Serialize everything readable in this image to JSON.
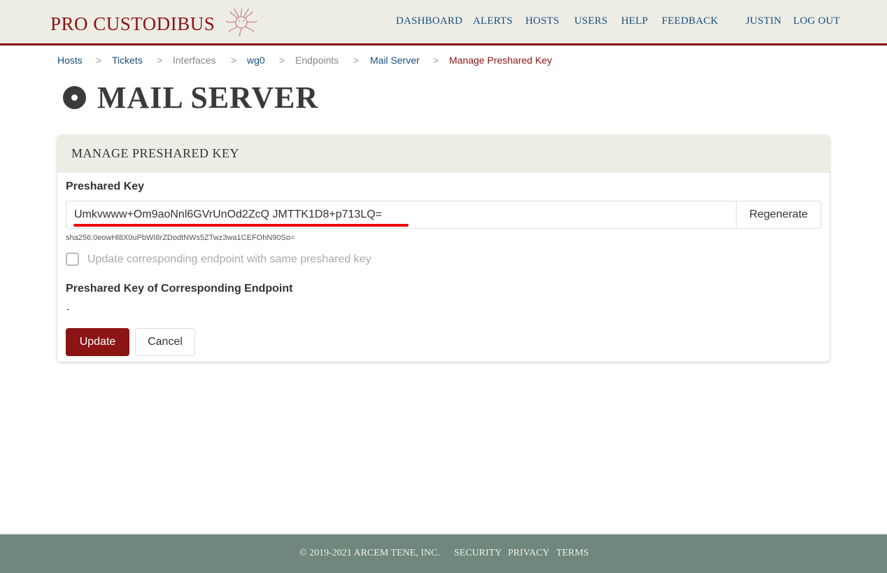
{
  "brand": {
    "name": "PRO CUSTODIBUS",
    "logo_icon": "medusa-icon"
  },
  "nav": {
    "items": [
      "DASHBOARD",
      "ALERTS",
      "HOSTS",
      "USERS",
      "HELP",
      "FEEDBACK"
    ],
    "user": "JUSTIN",
    "logout": "LOG OUT"
  },
  "breadcrumb": {
    "items": [
      {
        "label": "Hosts",
        "state": "link"
      },
      {
        "label": "Tickets",
        "state": "link"
      },
      {
        "label": "Interfaces",
        "state": "muted"
      },
      {
        "label": "wg0",
        "state": "link"
      },
      {
        "label": "Endpoints",
        "state": "muted"
      },
      {
        "label": "Mail Server",
        "state": "link"
      },
      {
        "label": "Manage Preshared Key",
        "state": "current"
      }
    ],
    "separator": ">"
  },
  "page": {
    "title": "MAIL SERVER",
    "title_icon": "endpoint-circle-icon"
  },
  "card": {
    "header": "MANAGE PRESHARED KEY",
    "preshared_key_label": "Preshared Key",
    "preshared_key_value": "Umkvwww+Om9aoNnl6GVrUnOd2ZcQ JMTTK1D8+p713LQ=",
    "regenerate_label": "Regenerate",
    "hash": "sha256:0eowHl8X0uPbWI8rZDodtNWs5ZTwz3wa1CEFOhN90So=",
    "checkbox_label": "Update corresponding endpoint with same preshared key",
    "checkbox_checked": false,
    "corresponding_label": "Preshared Key of Corresponding Endpoint",
    "corresponding_value": "-",
    "update_label": "Update",
    "cancel_label": "Cancel"
  },
  "footer": {
    "copyright": "© 2019-2021 ARCEM TENE, INC.",
    "links": [
      "SECURITY",
      "PRIVACY",
      "TERMS"
    ]
  },
  "colors": {
    "brand": "#8b1414",
    "link": "#184e7e",
    "header_bg": "#eeede5",
    "footer_bg": "#6f877c",
    "highlight": "#ee0000"
  }
}
